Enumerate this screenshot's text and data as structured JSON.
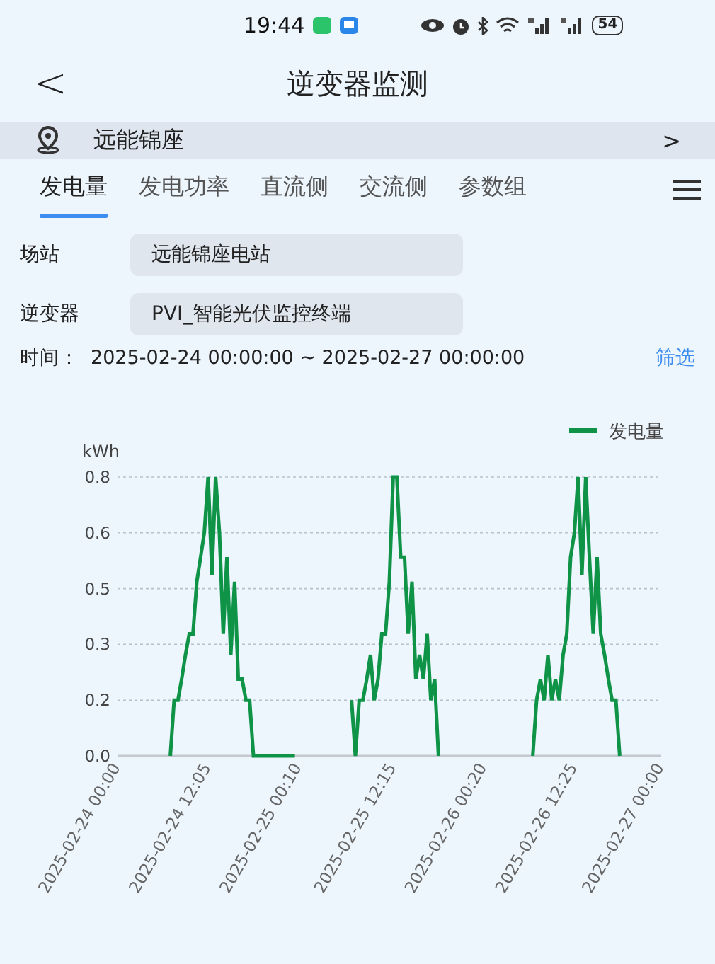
{
  "status_bar": {
    "time": "19:44",
    "battery": "54"
  },
  "header": {
    "back": "<",
    "title": "逆变器监测"
  },
  "location": {
    "name": "远能锦座",
    "arrow": ">"
  },
  "tabs": [
    {
      "label": "发电量",
      "selected": true
    },
    {
      "label": "发电功率",
      "selected": false
    },
    {
      "label": "直流侧",
      "selected": false
    },
    {
      "label": "交流侧",
      "selected": false
    },
    {
      "label": "参数组",
      "selected": false
    }
  ],
  "fields": [
    {
      "label": "场站",
      "value": "远能锦座电站"
    },
    {
      "label": "逆变器",
      "value": "PVI_智能光伏监控终端"
    }
  ],
  "time_range": {
    "label": "时间：",
    "value": "2025-02-24 00:00:00 ~ 2025-02-27 00:00:00",
    "filter": "筛选"
  },
  "chart": {
    "chart_data": {
      "type": "line",
      "ylabel": "kWh",
      "grid": true,
      "ylim": [
        0,
        0.8
      ],
      "yticks": [
        {
          "value": 0,
          "label": "0.0"
        },
        {
          "value": 0.16,
          "label": "0.2"
        },
        {
          "value": 0.32,
          "label": "0.3"
        },
        {
          "value": 0.48,
          "label": "0.5"
        },
        {
          "value": 0.64,
          "label": "0.6"
        },
        {
          "value": 0.8,
          "label": "0.8"
        }
      ],
      "categories": [
        "2025-02-24 00:00",
        null,
        null,
        null,
        null,
        null,
        null,
        null,
        null,
        null,
        null,
        null,
        null,
        null,
        null,
        null,
        null,
        null,
        null,
        null,
        null,
        null,
        null,
        null,
        "2025-02-24 12:05",
        null,
        null,
        null,
        null,
        null,
        null,
        null,
        null,
        null,
        null,
        null,
        null,
        null,
        null,
        null,
        null,
        null,
        null,
        null,
        null,
        null,
        null,
        null,
        "2025-02-25 00:10",
        null,
        null,
        null,
        null,
        null,
        null,
        null,
        null,
        null,
        null,
        null,
        null,
        null,
        null,
        null,
        null,
        null,
        null,
        null,
        null,
        null,
        null,
        null,
        null,
        "2025-02-25 12:15",
        null,
        null,
        null,
        null,
        null,
        null,
        null,
        null,
        null,
        null,
        null,
        null,
        null,
        null,
        null,
        null,
        null,
        null,
        null,
        null,
        null,
        null,
        null,
        "2025-02-26 00:20",
        null,
        null,
        null,
        null,
        null,
        null,
        null,
        null,
        null,
        null,
        null,
        null,
        null,
        null,
        null,
        null,
        null,
        null,
        null,
        null,
        null,
        null,
        null,
        "2025-02-26 12:25",
        null,
        null,
        null,
        null,
        null,
        null,
        null,
        null,
        null,
        null,
        null,
        null,
        null,
        null,
        null,
        null,
        null,
        null,
        null,
        null,
        null,
        null,
        "2025-02-27 00:00"
      ],
      "series": [
        {
          "name": "发电量",
          "color": "#0e9347",
          "values": [
            null,
            null,
            null,
            null,
            null,
            null,
            null,
            null,
            null,
            null,
            null,
            null,
            null,
            null,
            0,
            0.16,
            0.16,
            0.22,
            0.29,
            0.35,
            0.35,
            0.5,
            0.57,
            0.64,
            0.8,
            0.52,
            0.8,
            0.64,
            0.35,
            0.57,
            0.29,
            0.5,
            0.22,
            0.22,
            0.16,
            0.16,
            0,
            0,
            0,
            0,
            0,
            0,
            0,
            0,
            0,
            0,
            0,
            0,
            null,
            null,
            null,
            null,
            null,
            null,
            null,
            null,
            null,
            null,
            null,
            null,
            null,
            null,
            0.16,
            0,
            0.16,
            0.16,
            0.22,
            0.29,
            0.16,
            0.22,
            0.35,
            0.35,
            0.5,
            0.8,
            0.8,
            0.57,
            0.57,
            0.35,
            0.5,
            0.22,
            0.29,
            0.22,
            0.35,
            0.16,
            0.22,
            0,
            null,
            null,
            null,
            null,
            null,
            null,
            null,
            null,
            null,
            null,
            null,
            null,
            null,
            null,
            null,
            null,
            null,
            null,
            null,
            null,
            null,
            null,
            null,
            null,
            0,
            0.16,
            0.22,
            0.16,
            0.29,
            0.16,
            0.22,
            0.16,
            0.29,
            0.35,
            0.57,
            0.64,
            0.8,
            0.52,
            0.8,
            0.57,
            0.35,
            0.57,
            0.35,
            0.29,
            0.22,
            0.16,
            0.16,
            0,
            null,
            null,
            null,
            null,
            null,
            null,
            null,
            null,
            null,
            null,
            null
          ]
        }
      ]
    }
  }
}
